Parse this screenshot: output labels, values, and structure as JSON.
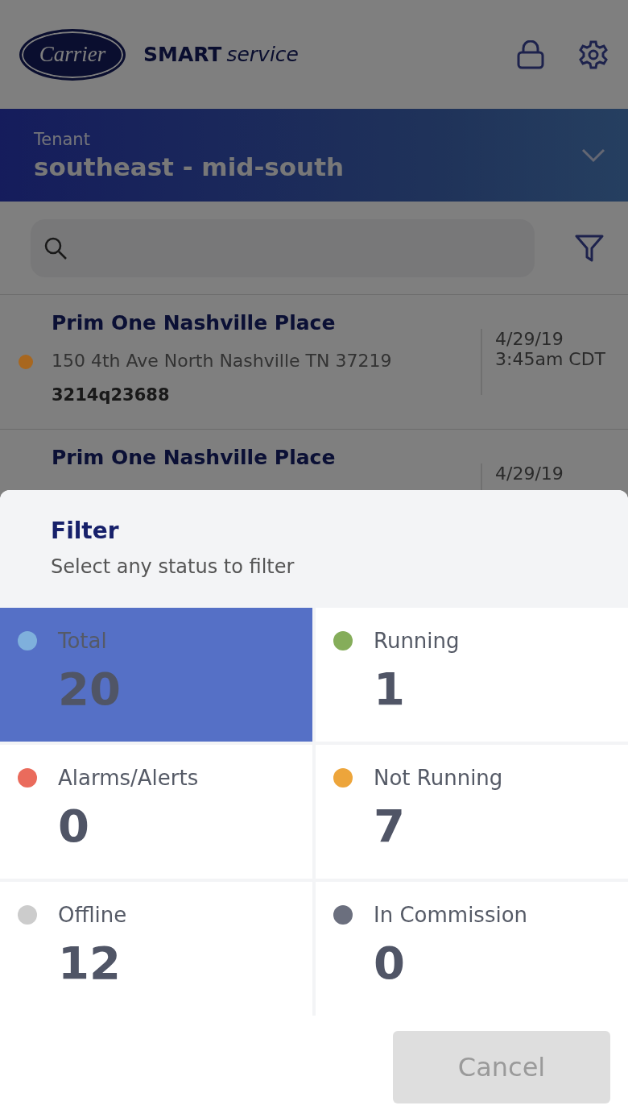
{
  "header": {
    "brand": "Carrier",
    "app_name_bold": "SMART",
    "app_name_italic": "service"
  },
  "tenant": {
    "label": "Tenant",
    "value": "southeast - mid-south"
  },
  "sites": [
    {
      "name": "Prim One Nashville Place",
      "address": "150 4th Ave North Nashville  TN 37219",
      "id": "3214q23688",
      "date": "4/29/19",
      "time": "3:45am CDT",
      "color": "#a8671f"
    },
    {
      "name": "Prim One Nashville Place",
      "date": "4/29/19"
    }
  ],
  "filter": {
    "title": "Filter",
    "subtitle": "Select any status to filter",
    "statuses": [
      {
        "label": "Total",
        "count": "20",
        "color": "#7fb0dc",
        "selected": true
      },
      {
        "label": "Running",
        "count": "1",
        "color": "#85ad5a",
        "selected": false
      },
      {
        "label": "Alarms/Alerts",
        "count": "0",
        "color": "#ea6b5c",
        "selected": false
      },
      {
        "label": "Not Running",
        "count": "7",
        "color": "#eda53b",
        "selected": false
      },
      {
        "label": "Offline",
        "count": "12",
        "color": "#cccccc",
        "selected": false
      },
      {
        "label": "In Commission",
        "count": "0",
        "color": "#6b6f7e",
        "selected": false
      }
    ],
    "cancel": "Cancel"
  }
}
